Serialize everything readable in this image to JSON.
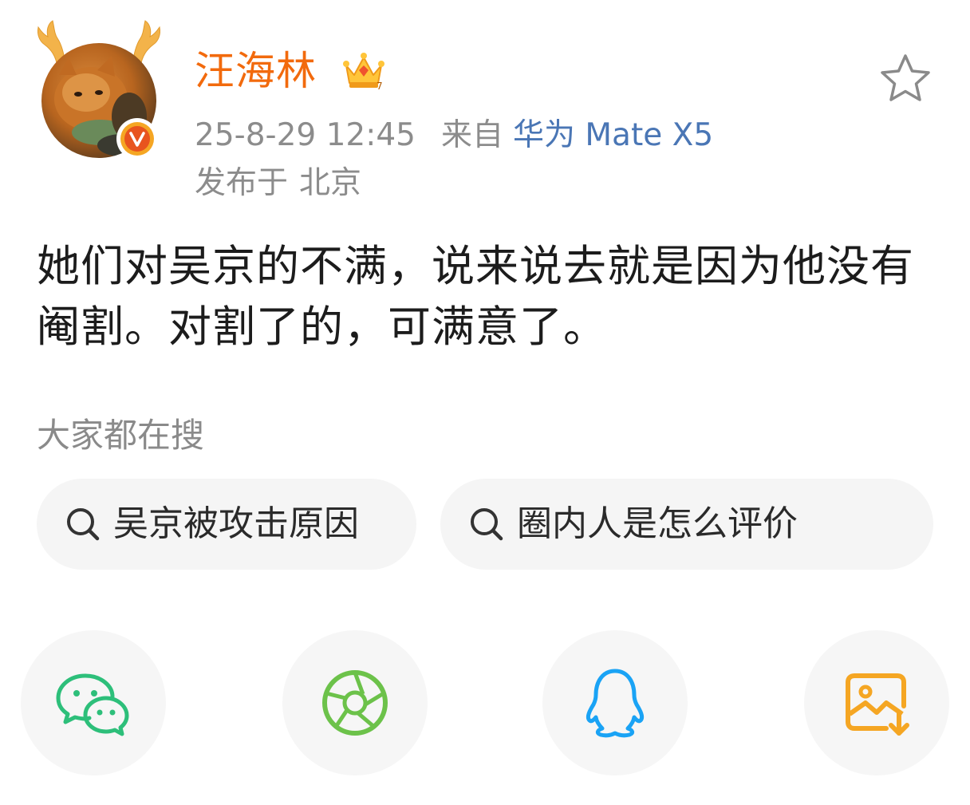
{
  "author": {
    "name": "汪海林",
    "avatar_icon": "cat-avatar-with-antlers",
    "badge_icon": "verified-v-badge",
    "level_icon": "crown-icon",
    "name_color": "#f26a0d"
  },
  "meta": {
    "time": "25-8-29 12:45",
    "source_prefix": "来自",
    "source_device": "华为 Mate X5",
    "location_prefix": "发布于",
    "location": "北京",
    "link_color": "#4a76b5"
  },
  "post": {
    "text": "她们对吴京的不满，说来说去就是因为他没有阉割。对割了的，可满意了。"
  },
  "search": {
    "title": "大家都在搜",
    "items": [
      {
        "label": "吴京被攻击原因",
        "icon": "search-icon"
      },
      {
        "label": "圈内人是怎么评价",
        "icon": "search-icon"
      }
    ]
  },
  "share": {
    "targets": [
      {
        "name": "wechat",
        "icon": "wechat-icon",
        "color": "#2dbf7a"
      },
      {
        "name": "moments",
        "icon": "aperture-icon",
        "color": "#6cc24a"
      },
      {
        "name": "qq",
        "icon": "qq-penguin-icon",
        "color": "#1aa3f5"
      },
      {
        "name": "save-image",
        "icon": "save-image-icon",
        "color": "#f5a623"
      }
    ]
  },
  "favorite": {
    "icon": "star-outline-icon"
  }
}
